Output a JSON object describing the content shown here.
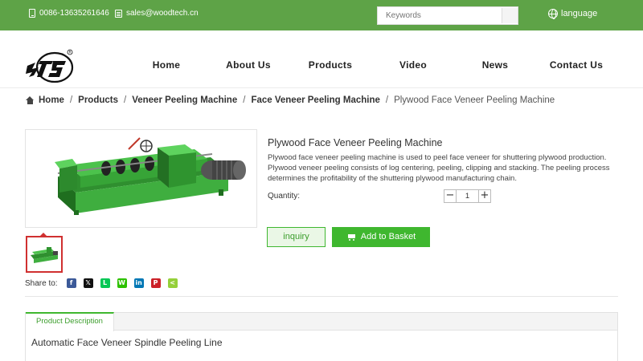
{
  "topbar": {
    "phone": "0086-13635261646",
    "email": "sales@woodtech.cn",
    "search_placeholder": "Keywords",
    "language": "language"
  },
  "nav": {
    "items": [
      "Home",
      "About Us",
      "Products",
      "Video",
      "News",
      "Contact Us"
    ]
  },
  "breadcrumb": {
    "items": [
      "Home",
      "Products",
      "Veneer Peeling Machine",
      "Face Veneer Peeling Machine"
    ],
    "current": "Plywood Face Veneer Peeling Machine"
  },
  "product": {
    "title": "Plywood Face Veneer Peeling Machine",
    "description": "Plywood face veneer peeling machine is used to peel face veneer for shuttering plywood production. Plywood veneer peeling consists of log centering, peeling, clipping and stacking. The peeling process determines the profitability of the shuttering plywood manufacturing chain.",
    "quantity_label": "Quantity:",
    "quantity_value": "1",
    "minus": "−",
    "plus": "+",
    "inquiry_label": "inquiry",
    "basket_label": "Add to Basket"
  },
  "share": {
    "label": "Share to:",
    "icons": [
      {
        "name": "facebook-icon",
        "glyph": "f",
        "color": "#3b5998"
      },
      {
        "name": "x-twitter-icon",
        "glyph": "𝕏",
        "color": "#111111"
      },
      {
        "name": "line-icon",
        "glyph": "L",
        "color": "#06c755"
      },
      {
        "name": "wechat-icon",
        "glyph": "W",
        "color": "#2dc100"
      },
      {
        "name": "linkedin-icon",
        "glyph": "in",
        "color": "#0077b5"
      },
      {
        "name": "pinterest-icon",
        "glyph": "P",
        "color": "#cb2027"
      },
      {
        "name": "sharethis-icon",
        "glyph": "<",
        "color": "#95d03a"
      }
    ]
  },
  "tabs": {
    "active": "Product Description",
    "content_title": "Automatic Face Veneer Spindle Peeling Line"
  },
  "colors": {
    "topbar": "#5ea347",
    "accent": "#3fb72f",
    "thumb_border": "#d03030"
  }
}
